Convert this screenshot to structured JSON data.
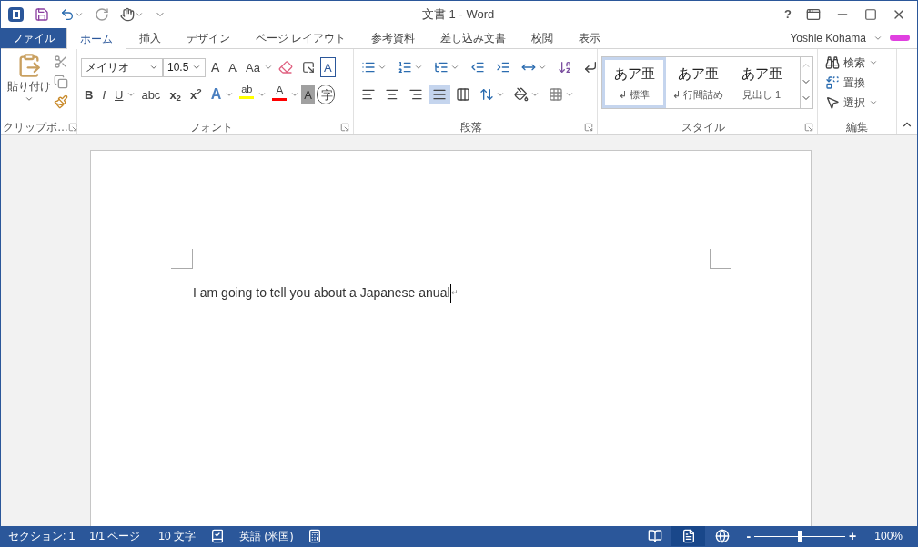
{
  "window": {
    "title": "文書 1 - Word",
    "help": "?"
  },
  "ribbon_tabs": [
    {
      "label": "ファイル",
      "kind": "file",
      "selected": false
    },
    {
      "label": "ホーム",
      "kind": "tab",
      "selected": true
    },
    {
      "label": "挿入",
      "kind": "tab",
      "selected": false
    },
    {
      "label": "デザイン",
      "kind": "tab",
      "selected": false
    },
    {
      "label": "ページ レイアウト",
      "kind": "tab",
      "selected": false
    },
    {
      "label": "参考資料",
      "kind": "tab",
      "selected": false
    },
    {
      "label": "差し込み文書",
      "kind": "tab",
      "selected": false
    },
    {
      "label": "校閲",
      "kind": "tab",
      "selected": false
    },
    {
      "label": "表示",
      "kind": "tab",
      "selected": false
    }
  ],
  "user": {
    "name": "Yoshie Kohama"
  },
  "clipboard": {
    "paste": "貼り付け",
    "label": "クリップボ…"
  },
  "font": {
    "name": "メイリオ",
    "size": "10.5",
    "grow": "A",
    "shrink": "A",
    "case": "Aa",
    "border": "A",
    "format_buttons": [
      "B",
      "I",
      "U",
      "abc",
      "x$_{2}$",
      "x$^{2}$"
    ],
    "effects": "A",
    "highlight": "ab",
    "font_color_letter": "A",
    "shading": "A",
    "enclosed": "字",
    "label": "フォント"
  },
  "paragraph": {
    "label": "段落",
    "alignments": [
      {
        "kind": "left",
        "selected": false
      },
      {
        "kind": "center",
        "selected": false
      },
      {
        "kind": "right",
        "selected": false
      },
      {
        "kind": "justify",
        "selected": true
      },
      {
        "kind": "distributed",
        "selected": false
      }
    ]
  },
  "styles": {
    "label": "スタイル",
    "items": [
      {
        "preview": "あア亜",
        "name": "標準",
        "mark": "↲",
        "selected": true
      },
      {
        "preview": "あア亜",
        "name": "行間詰め",
        "mark": "↲",
        "selected": false
      },
      {
        "preview": "あア亜",
        "name": "見出し 1",
        "selected": false
      }
    ]
  },
  "editing": {
    "label": "編集",
    "find": "検索",
    "replace": "置換",
    "select": "選択"
  },
  "document": {
    "text": "I am going to tell you about a Japanese anual",
    "mark": "↵"
  },
  "status_bar": {
    "section": "セクション: 1",
    "page": "1/1 ページ",
    "words": "10 文字",
    "language": "英語 (米国)",
    "views": [
      {
        "kind": "read",
        "selected": false
      },
      {
        "kind": "print",
        "selected": true
      },
      {
        "kind": "web",
        "selected": false
      }
    ],
    "zoom_minus": "-",
    "zoom_plus": "+",
    "zoom": {
      "level": 0.5
    },
    "zoom_reading": "100%"
  }
}
